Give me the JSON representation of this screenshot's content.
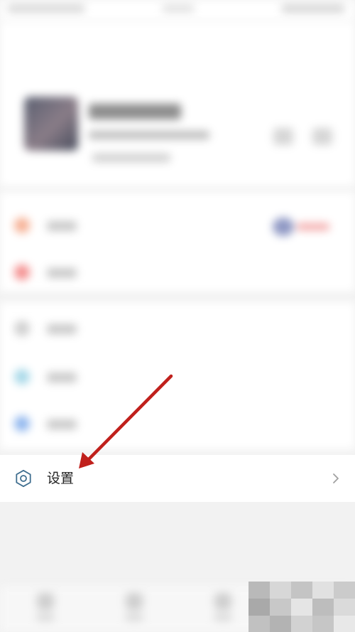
{
  "settings": {
    "label": "设置",
    "icon": "gear-icon",
    "chevron": "chevron-right-icon"
  },
  "colors": {
    "accent_arrow": "#c0201c",
    "settings_icon": "#3f6e8f",
    "chevron": "#a0a0a0",
    "background": "#f2f2f2"
  },
  "annotation": {
    "type": "arrow",
    "points_to": "settings-row"
  }
}
